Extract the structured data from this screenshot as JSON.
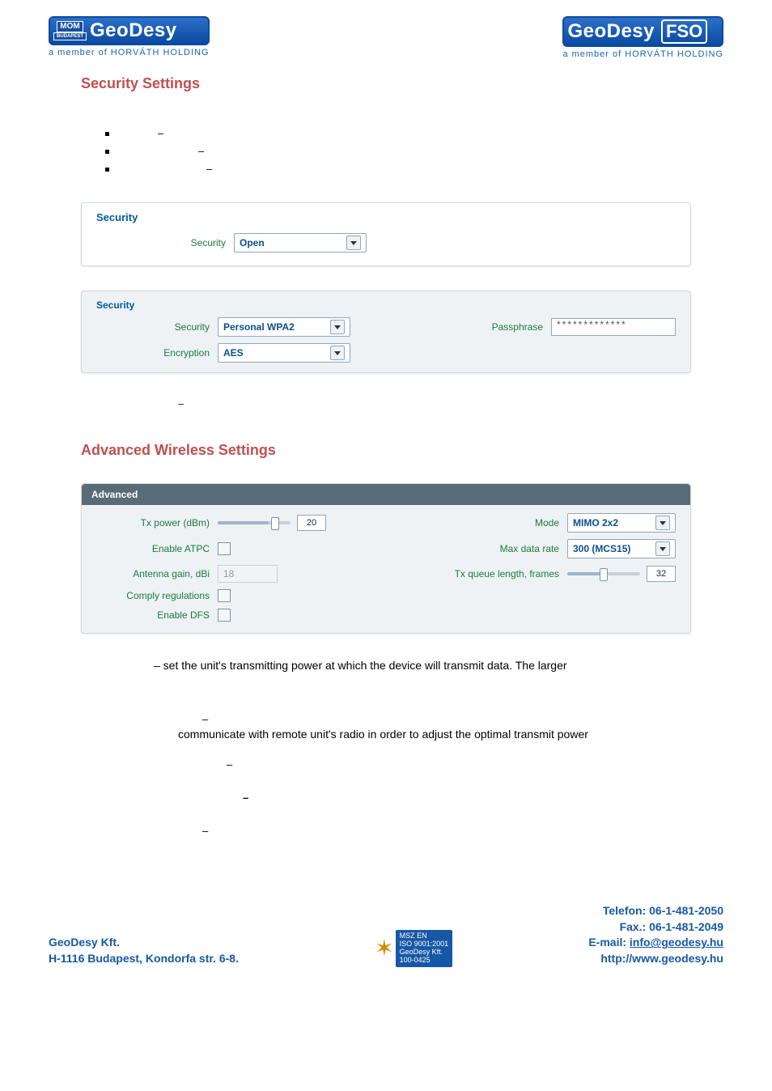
{
  "header": {
    "logo_left": {
      "mom": "MOM",
      "sub": "BUDAPEST",
      "brand": "GeoDesy",
      "tagline": "a member of HORVÁTH HOLDING"
    },
    "logo_right": {
      "brand": "GeoDesy",
      "fso": "FSO",
      "tagline": "a member of HORVÁTH HOLDING"
    }
  },
  "titles": {
    "security": "Security Settings",
    "advanced": "Advanced Wireless Settings"
  },
  "security_open": {
    "panel_title": "Security",
    "label": "Security",
    "value": "Open"
  },
  "security_wpa": {
    "panel_title": "Security",
    "sec_label": "Security",
    "sec_value": "Personal WPA2",
    "enc_label": "Encryption",
    "enc_value": "AES",
    "pass_label": "Passphrase",
    "pass_value": "*************"
  },
  "advanced_panel": {
    "title": "Advanced",
    "txpower_label": "Tx power (dBm)",
    "txpower_value": "20",
    "atpc_label": "Enable ATPC",
    "antenna_label": "Antenna gain, dBi",
    "antenna_value": "18",
    "comply_label": "Comply regulations",
    "dfs_label": "Enable DFS",
    "mode_label": "Mode",
    "mode_value": "MIMO 2x2",
    "rate_label": "Max data rate",
    "rate_value": "300 (MCS15)",
    "txq_label": "Tx queue length, frames",
    "txq_value": "32"
  },
  "paragraphs": {
    "p1": "– set the unit's transmitting power at which the device will transmit data. The larger",
    "p2": "communicate with remote unit's radio in order to adjust the optimal transmit power"
  },
  "dashes": {
    "d": "–"
  },
  "footer": {
    "left1": "GeoDesy Kft.",
    "left2": "H-1116 Budapest, Kondorfa str. 6-8.",
    "cert1": "MSZ EN",
    "cert2": "ISO 9001:2001",
    "cert3": "GeoDesy Kft.",
    "cert4": "100-0425",
    "r1": "Telefon: 06-1-481-2050",
    "r2": "Fax.: 06-1-481-2049",
    "r3a": "E-mail: ",
    "r3b": "info@geodesy.hu",
    "r4": "http://www.geodesy.hu"
  },
  "chart_data": null
}
